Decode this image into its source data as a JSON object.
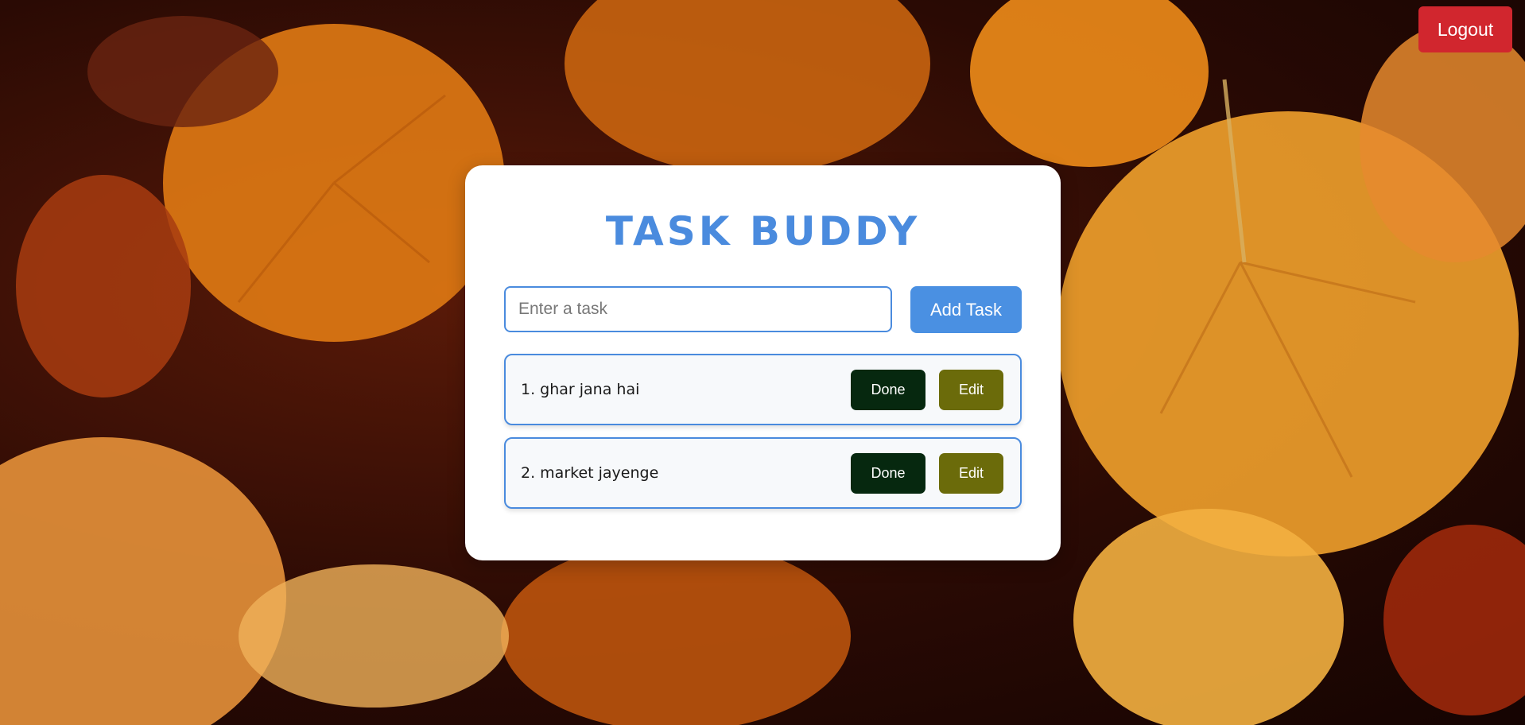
{
  "header": {
    "logout_label": "Logout"
  },
  "app": {
    "title": "TASK BUDDY"
  },
  "task_form": {
    "placeholder": "Enter a task",
    "value": "",
    "add_label": "Add Task"
  },
  "tasks": [
    {
      "text": "1. ghar jana hai",
      "done_label": "Done",
      "edit_label": "Edit"
    },
    {
      "text": "2. market jayenge",
      "done_label": "Done",
      "edit_label": "Edit"
    }
  ],
  "colors": {
    "accent": "#4a8bde",
    "add_button": "#4a90e2",
    "logout": "#d1262e",
    "done": "#06280f",
    "edit": "#6b6b0a"
  }
}
